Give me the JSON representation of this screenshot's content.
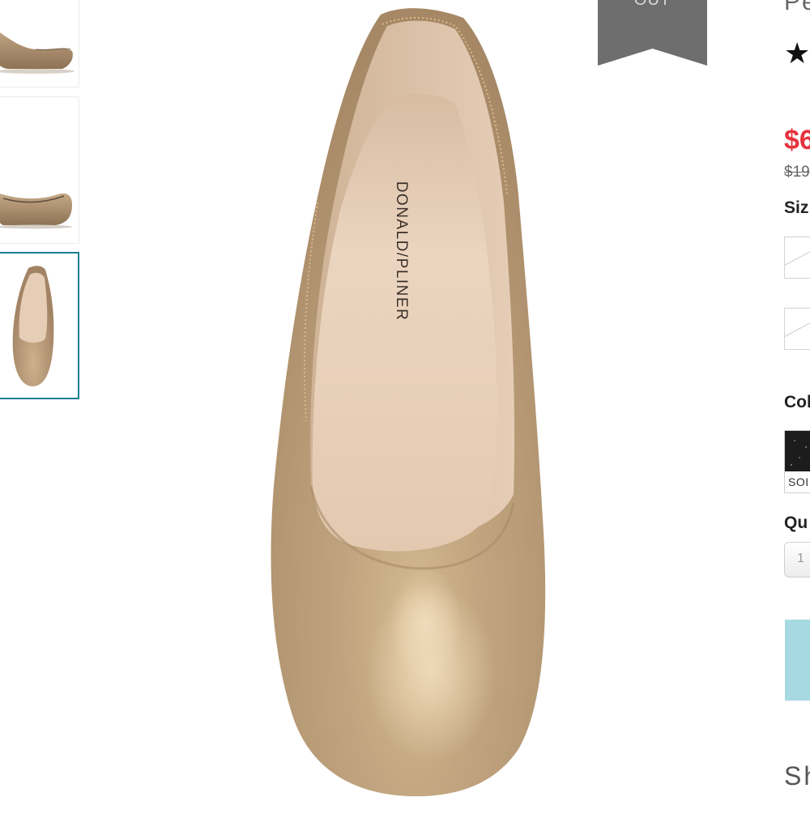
{
  "badge": {
    "label": "OUT"
  },
  "product": {
    "title": "Pe",
    "rating_icon": "star-icon",
    "rating_star": "★",
    "sale_price": "$6",
    "original_price": "$19"
  },
  "options": {
    "size_label": "Siz",
    "color_label": "Col",
    "color_swatch_label": "SOI",
    "quantity_label": "Qu",
    "quantity_value": "1"
  },
  "brand_mark": "DONALD/PLINER",
  "footer": {
    "section_heading": "Sh"
  },
  "colors": {
    "sale_price": "#e5333e",
    "selected_thumbnail_border": "#1a7f94",
    "add_to_bag_button": "#a7d9e3",
    "badge": "#6e6e6e",
    "shoe": "#b89c7b"
  }
}
